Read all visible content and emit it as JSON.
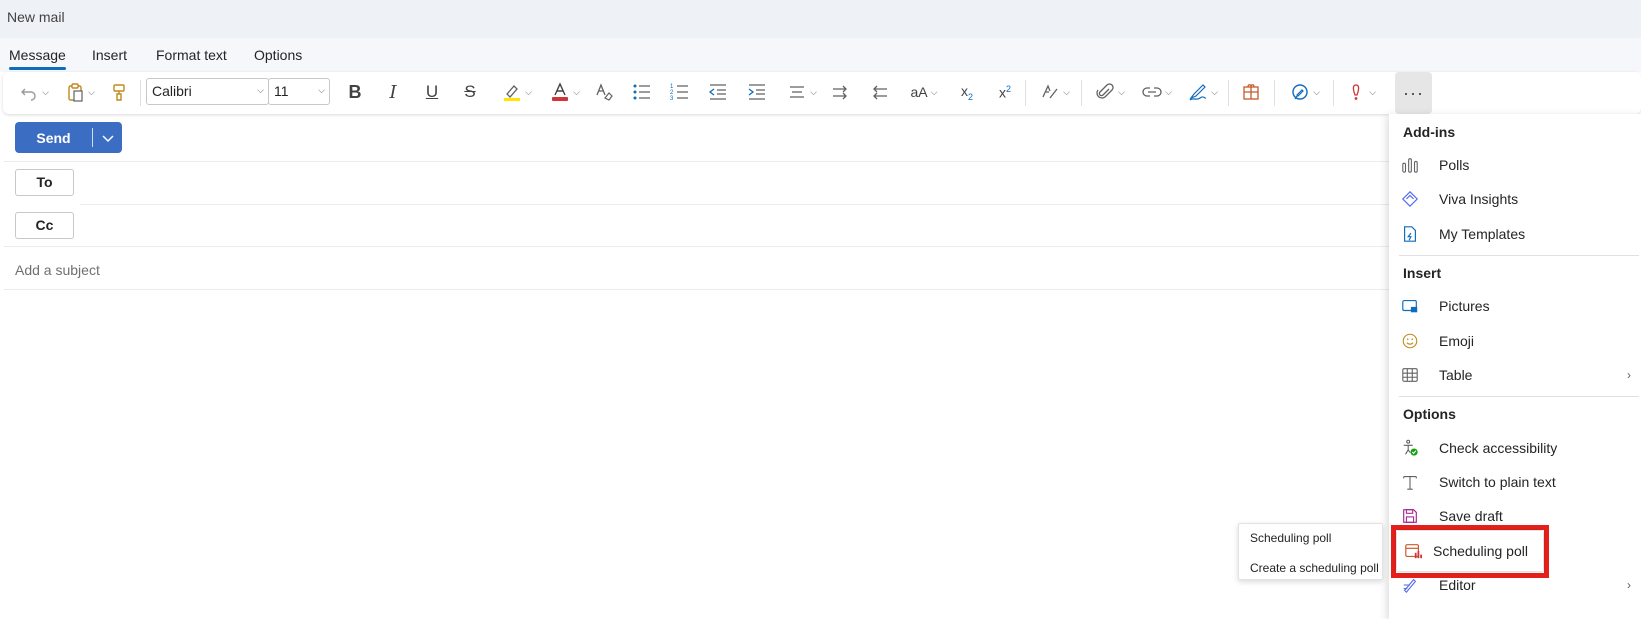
{
  "window": {
    "title": "New mail"
  },
  "tabs": [
    {
      "label": "Message",
      "active": true
    },
    {
      "label": "Insert"
    },
    {
      "label": "Format text"
    },
    {
      "label": "Options"
    }
  ],
  "ribbon": {
    "font_name": "Calibri",
    "font_size": "11",
    "more_label": "···",
    "icons": [
      "undo-icon",
      "paste-icon",
      "format-painter-icon",
      "bold-icon",
      "italic-icon",
      "underline-icon",
      "strikethrough-icon",
      "highlight-icon",
      "font-color-icon",
      "clear-formatting-icon",
      "bullets-icon",
      "numbering-icon",
      "decrease-indent-icon",
      "increase-indent-icon",
      "align-icon",
      "text-direction-ltr-icon",
      "text-direction-rtl-icon",
      "change-case-icon",
      "subscript-icon",
      "superscript-icon",
      "styles-icon",
      "attach-icon",
      "link-icon",
      "signature-icon",
      "apps-icon",
      "editor-icon",
      "importance-icon",
      "more-icon"
    ],
    "accent": {
      "highlight": "#ffe600",
      "font_color": "#d13438"
    }
  },
  "compose": {
    "send_label": "Send",
    "to_label": "To",
    "cc_label": "Cc",
    "subject_placeholder": "Add a subject"
  },
  "overflow_menu": {
    "addins_header": "Add-ins",
    "addins": [
      {
        "label": "Polls",
        "icon": "polls-icon"
      },
      {
        "label": "Viva Insights",
        "icon": "viva-insights-icon"
      },
      {
        "label": "My Templates",
        "icon": "templates-icon"
      }
    ],
    "insert_header": "Insert",
    "insert": [
      {
        "label": "Pictures",
        "icon": "pictures-icon"
      },
      {
        "label": "Emoji",
        "icon": "emoji-icon"
      },
      {
        "label": "Table",
        "icon": "table-icon",
        "arrow": "›"
      }
    ],
    "options_header": "Options",
    "options": [
      {
        "label": "Check accessibility",
        "icon": "accessibility-icon"
      },
      {
        "label": "Switch to plain text",
        "icon": "plain-text-icon"
      },
      {
        "label": "Save draft",
        "icon": "save-icon"
      },
      {
        "label": "Scheduling poll",
        "icon": "scheduling-poll-icon"
      },
      {
        "label": "Editor",
        "icon": "editor-icon",
        "arrow": "›"
      }
    ],
    "highlight_color": "#e3201b"
  },
  "tooltip_popup": {
    "title": "Scheduling poll",
    "description": "Create a scheduling poll"
  }
}
